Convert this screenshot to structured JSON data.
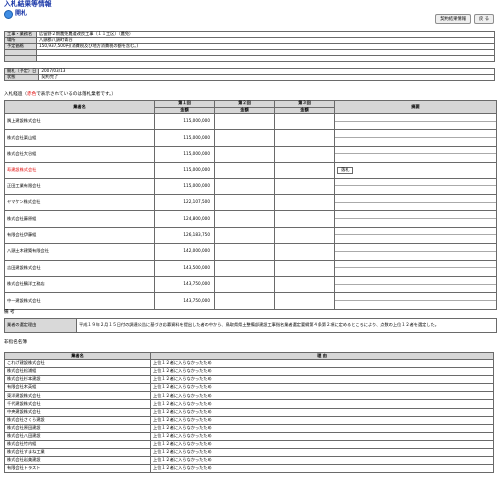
{
  "page": {
    "title": "入札結果等情報",
    "subtitle": "開札"
  },
  "buttons": {
    "contract_info": "契約結果情報",
    "back": "戻 る"
  },
  "info": {
    "rows": [
      {
        "label": "工事・業務名",
        "value": "広留野２期農免農道改良工事（１１工区）（農免）"
      },
      {
        "label": "場所",
        "value": "八頭郡八頭町青谷"
      },
      {
        "label": "予定価格",
        "value": "150,937,500円(消費税及び地方消費税の額を含む。)"
      },
      {
        "label": "",
        "value": ""
      },
      {
        "label": "",
        "value": ""
      }
    ]
  },
  "status": {
    "rows": [
      {
        "label": "開札（予定）日",
        "value": "2007/03/13"
      },
      {
        "label": "状態",
        "value": "契約完了"
      }
    ]
  },
  "results": {
    "caption_before": "入札経過（",
    "caption_red": "赤色",
    "caption_after": "で表示されているのは落札業者です。）",
    "headers": {
      "company": "業者名",
      "round1": "第１回",
      "round2": "第２回",
      "round3": "第３回",
      "amount": "金額",
      "remarks": "摘要"
    },
    "rows": [
      {
        "company": "隅上建設株式会社",
        "amount1": "115,000,000"
      },
      {
        "company": "株式会社栗山組",
        "amount1": "115,000,000"
      },
      {
        "company": "株式会社大谷組",
        "amount1": "115,000,000"
      },
      {
        "company": "寿建設株式会社",
        "amount1": "115,000,000",
        "winner": true,
        "remark": "落札"
      },
      {
        "company": "正田工業有限会社",
        "amount1": "115,000,000"
      },
      {
        "company": "ヤマケン株式会社",
        "amount1": "122,107,500"
      },
      {
        "company": "株式会社藤原組",
        "amount1": "124,800,000"
      },
      {
        "company": "有限会社伊藤組",
        "amount1": "126,183,750"
      },
      {
        "company": "八頭土木建築有限会社",
        "amount1": "142,000,000"
      },
      {
        "company": "吉田建設株式会社",
        "amount1": "143,500,000"
      },
      {
        "company": "株式会社鶴洋工務店",
        "amount1": "143,750,000"
      },
      {
        "company": "中一建設株式会社",
        "amount1": "143,750,000"
      }
    ]
  },
  "notes": {
    "section_label": "備 考",
    "label": "業者の選定理由",
    "text": "平成１９年２月１５日付の調達公告に基づき応募資料を提出した者の中から、鳥取県県土整備部建設工事指名業者選定要綱第４条第２項に定めるところにより、点数の上位１２者を選定した。"
  },
  "nominees": {
    "section_label": "非指名名簿",
    "headers": {
      "company": "業者名",
      "reason": "理 由"
    },
    "rows": [
      {
        "company": "これげ建設株式会社",
        "reason": "上位１２者に入らなかったため"
      },
      {
        "company": "株式会社松浦組",
        "reason": "上位１２者に入らなかったため"
      },
      {
        "company": "株式会社杉本建設",
        "reason": "上位１２者に入らなかったため"
      },
      {
        "company": "有限会社木英組",
        "reason": "上位１２者に入らなかったため"
      },
      {
        "company": "東洋建設株式会社",
        "reason": "上位１２者に入らなかったため"
      },
      {
        "company": "千代建設株式会社",
        "reason": "上位１２者に入らなかったため"
      },
      {
        "company": "中央建設株式会社",
        "reason": "上位１２者に入らなかったため"
      },
      {
        "company": "株式会社さくら建設",
        "reason": "上位１２者に入らなかったため"
      },
      {
        "company": "株式会社原田建設",
        "reason": "上位１２者に入らなかったため"
      },
      {
        "company": "株式会社八田建設",
        "reason": "上位１２者に入らなかったため"
      },
      {
        "company": "株式会社竹内組",
        "reason": "上位１２者に入らなかったため"
      },
      {
        "company": "株式会社すまね工業",
        "reason": "上位１２者に入らなかったため"
      },
      {
        "company": "株式会社岩美建設",
        "reason": "上位１２者に入らなかったため"
      },
      {
        "company": "有限会社トラスト",
        "reason": "上位１２者に入らなかったため"
      }
    ]
  },
  "colors": {
    "title_blue": "#1a37a8",
    "winner_red": "#e00000",
    "header_gray": "#d6d6d6"
  }
}
